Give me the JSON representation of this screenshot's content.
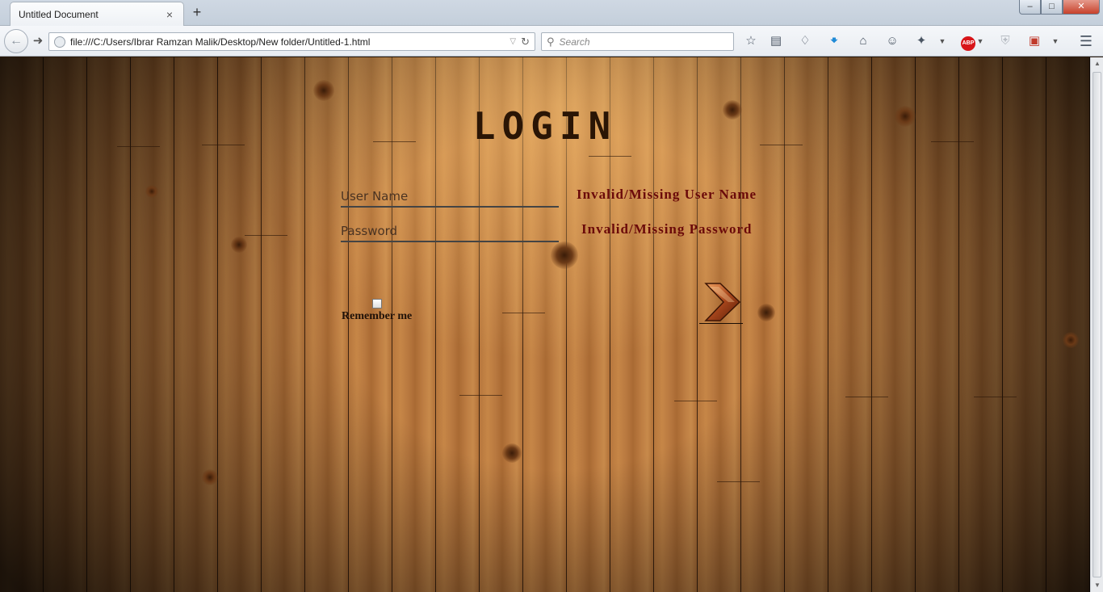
{
  "browser": {
    "tab_title": "Untitled Document",
    "tab_close": "×",
    "new_tab": "+",
    "window_controls": {
      "minimize": "–",
      "maximize": "□",
      "close": "✕"
    },
    "url": "file:///C:/Users/Ibrar Ramzan Malik/Desktop/New folder/Untitled-1.html",
    "search_placeholder": "Search",
    "toolbar_icons": [
      "bookmark-star-icon",
      "reading-list-icon",
      "pocket-icon",
      "download-icon",
      "home-icon",
      "chat-icon",
      "extension-icon",
      "adblock-icon",
      "shield-icon",
      "translate-icon",
      "menu-icon"
    ],
    "adblock_label": "ABP"
  },
  "page": {
    "title": "LOGIN",
    "username_placeholder": "User Name",
    "password_placeholder": "Password",
    "username_error": "Invalid/Missing User Name",
    "password_error": "Invalid/Missing Password",
    "remember_label": "Remember me",
    "remember_checked": false,
    "colors": {
      "error": "#6b0a0a",
      "title": "#2a1505",
      "wood": "#b7773d"
    }
  }
}
